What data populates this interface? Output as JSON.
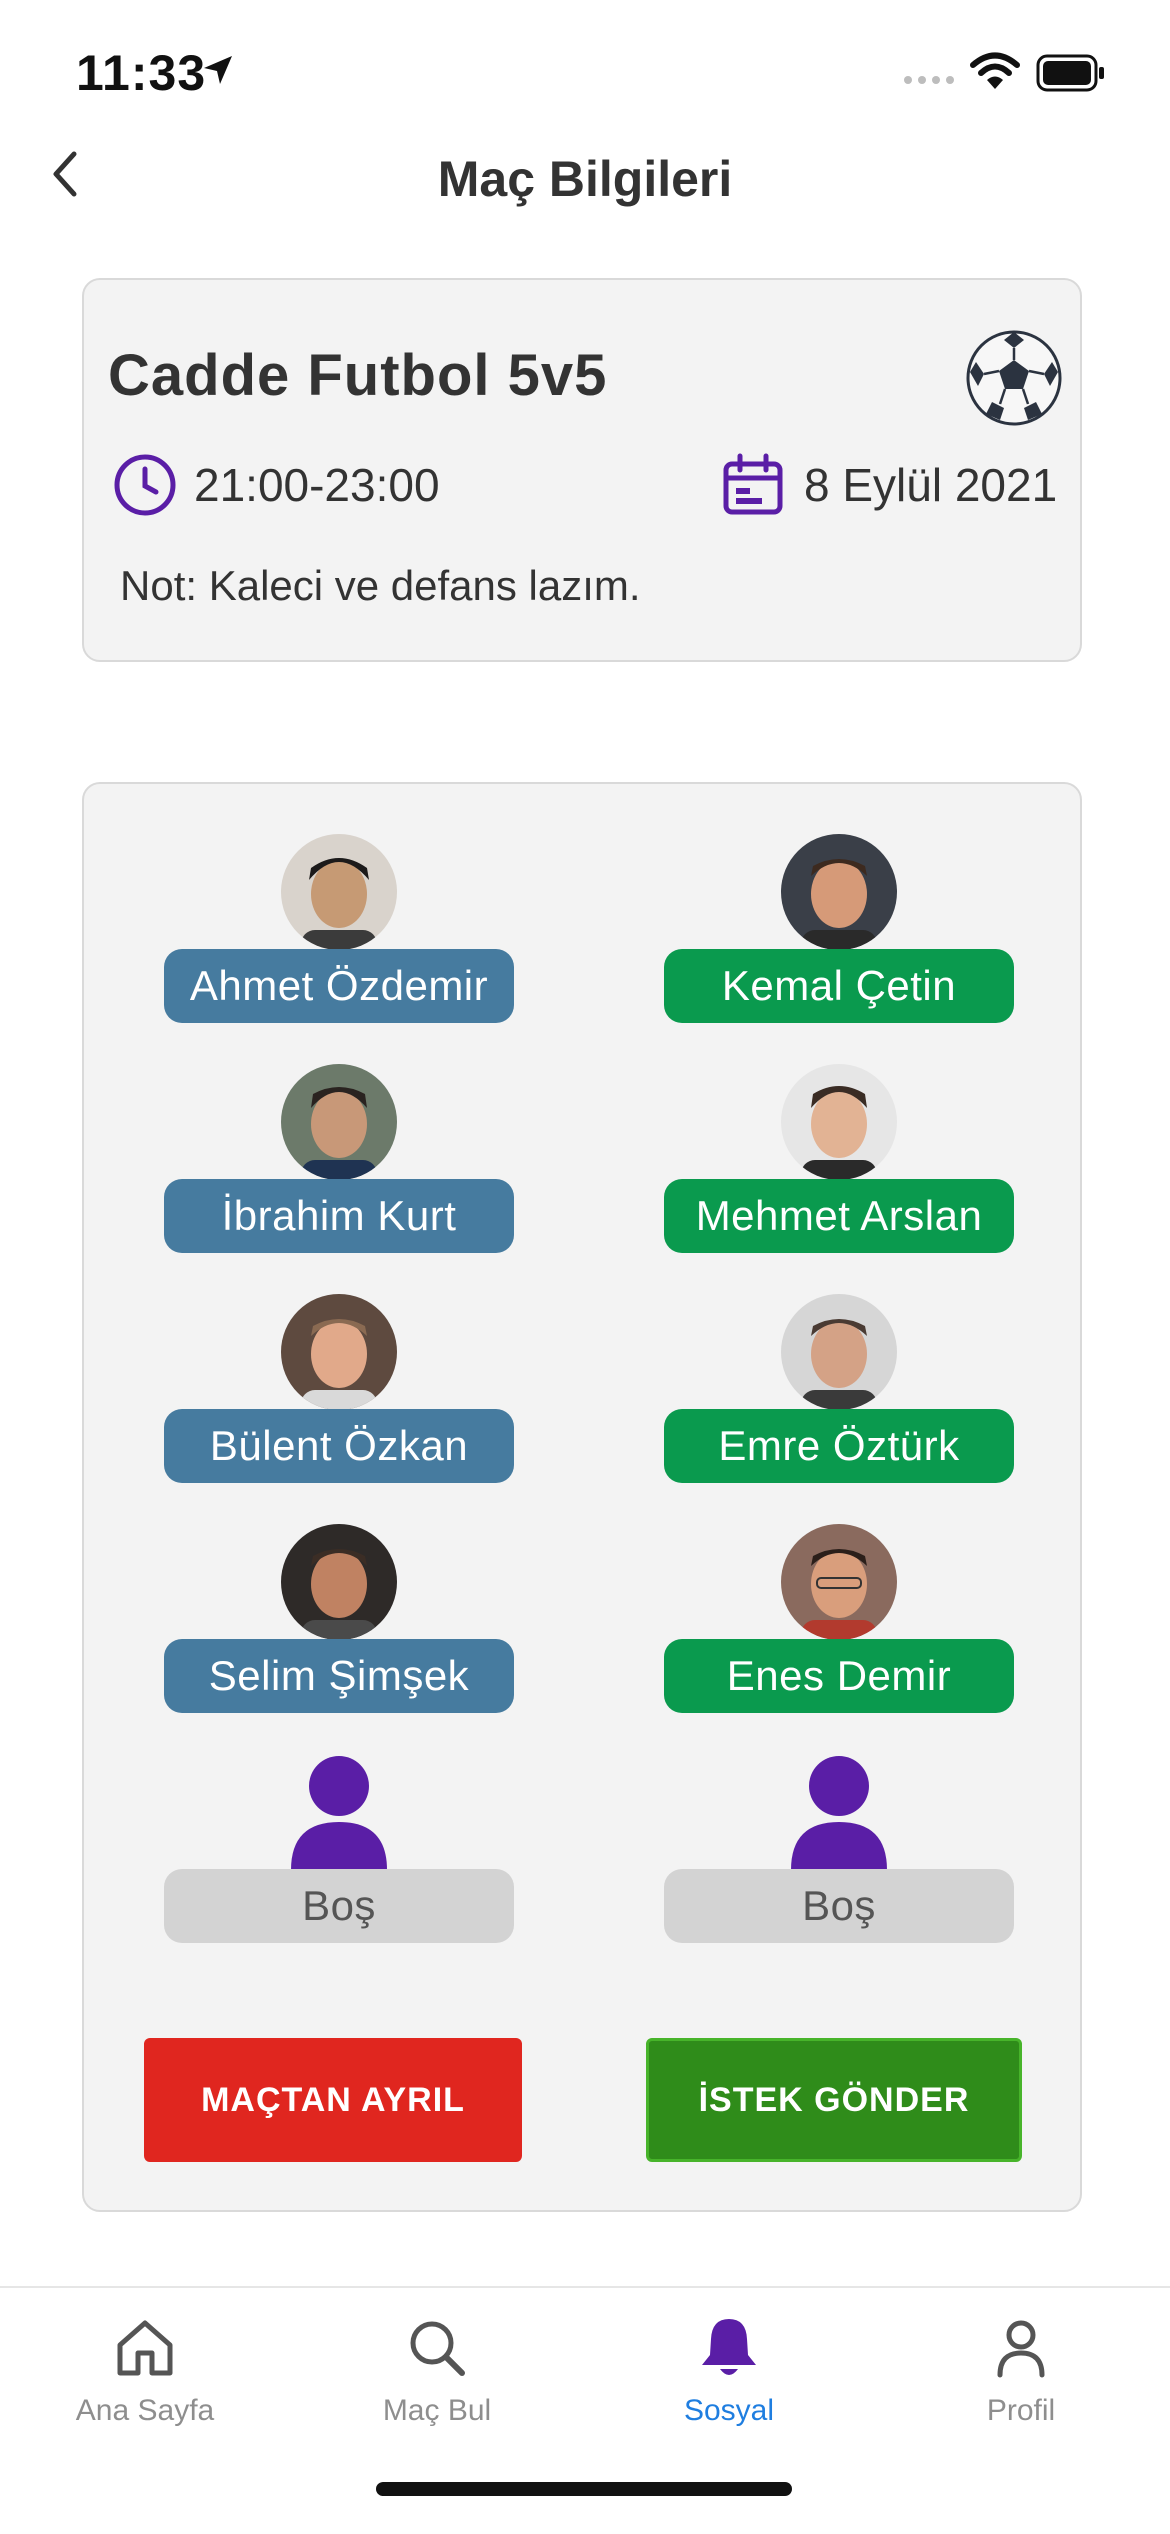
{
  "status_bar": {
    "time": "11:33"
  },
  "header": {
    "title": "Maç Bilgileri"
  },
  "match": {
    "name": "Cadde Futbol 5v5",
    "time_range": "21:00-23:00",
    "date": "8 Eylül 2021",
    "note": "Not: Kaleci ve defans lazım."
  },
  "teams": {
    "left": [
      {
        "name": "Ahmet Özdemir"
      },
      {
        "name": "İbrahim Kurt"
      },
      {
        "name": "Bülent Özkan"
      },
      {
        "name": "Selim Şimşek"
      },
      {
        "name": "Boş"
      }
    ],
    "right": [
      {
        "name": "Kemal Çetin"
      },
      {
        "name": "Mehmet Arslan"
      },
      {
        "name": "Emre Öztürk"
      },
      {
        "name": "Enes Demir"
      },
      {
        "name": "Boş"
      }
    ]
  },
  "actions": {
    "leave_label": "MAÇTAN AYRIL",
    "request_label": "İSTEK GÖNDER"
  },
  "tabbar": {
    "items": [
      {
        "label": "Ana Sayfa",
        "icon": "home-icon"
      },
      {
        "label": "Maç Bul",
        "icon": "search-icon"
      },
      {
        "label": "Sosyal",
        "icon": "bell-icon"
      },
      {
        "label": "Profil",
        "icon": "person-icon"
      }
    ],
    "active": "Sosyal"
  },
  "colors": {
    "accent": "#5a1ea6",
    "team_left": "#467b9f",
    "team_right": "#0a9a4e",
    "leave": "#e0261f",
    "request": "#2f8c1a",
    "tab_active": "#1f7ee0"
  }
}
